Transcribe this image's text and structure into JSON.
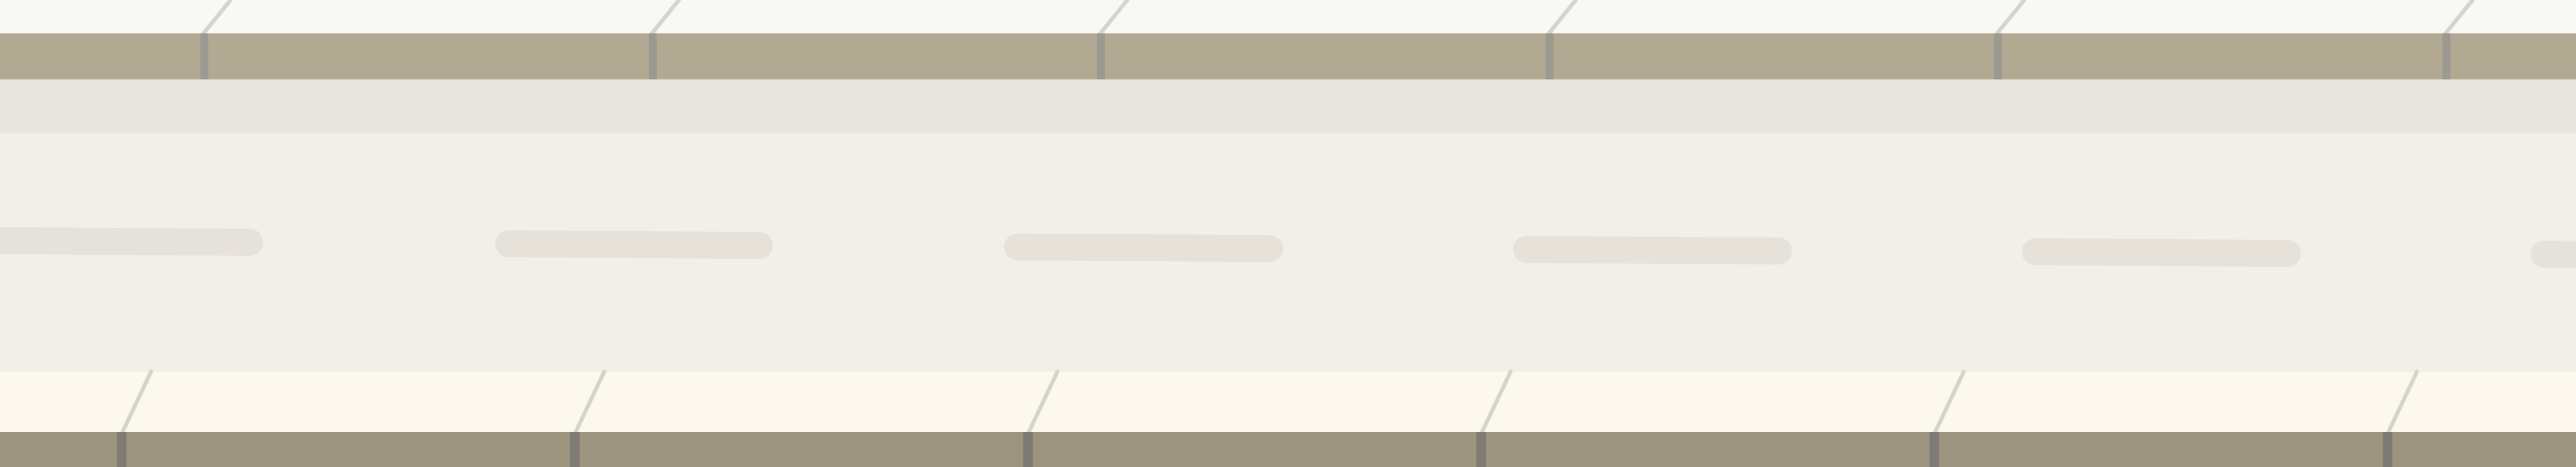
{
  "scene": {
    "type": "road-strip",
    "colors": {
      "background": "#f8f8f7",
      "top_curb": "#b2a993",
      "top_curb_joint": "#9d9890",
      "sidewalk_edge": "#e6e5e0",
      "road_surface": "#f2efe9",
      "lane_marking": "#e6e2da",
      "bottom_strip": "#fcf8ed",
      "bottom_curb": "#9c947f",
      "bottom_curb_joint": "#7f7a73",
      "slant_line": "#d6d3cd"
    },
    "counts": {
      "top_joints": 6,
      "bottom_joints": 6,
      "lane_dashes": 6
    }
  }
}
